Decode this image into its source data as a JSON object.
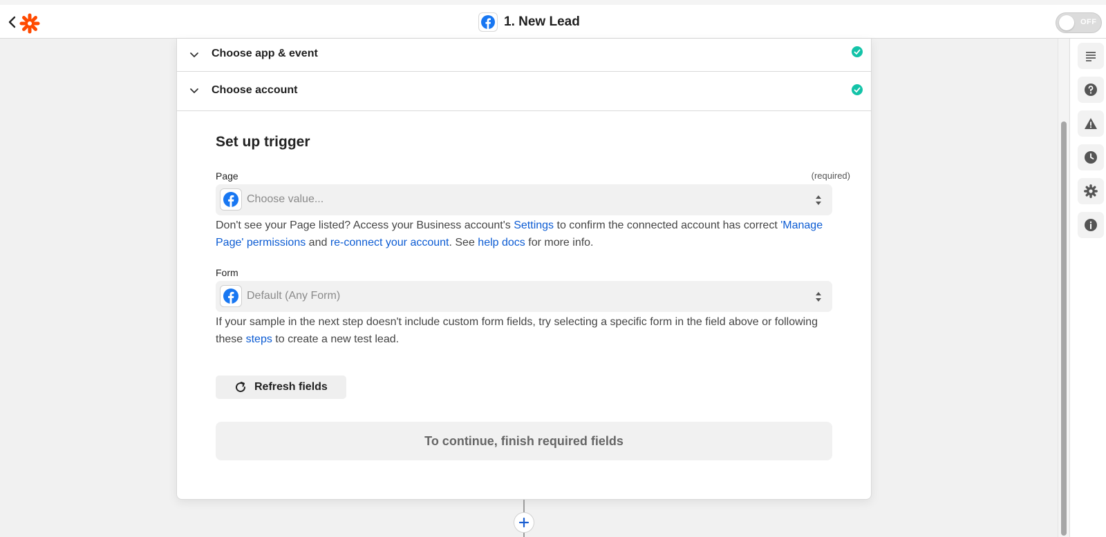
{
  "header": {
    "title": "1. New Lead",
    "toggle_label": "OFF"
  },
  "sections": {
    "app_event": "Choose app & event",
    "account": "Choose account"
  },
  "setup": {
    "title": "Set up trigger",
    "page_label": "Page",
    "required": "(required)",
    "page_placeholder": "Choose value...",
    "page_help": {
      "t1": "Don't see your Page listed? Access your Business account's ",
      "settings": "Settings",
      "t2": " to confirm the connected account has correct ",
      "manage": "'Manage Page' permissions",
      "t3": " and ",
      "reconnect": "re-connect your account",
      "t4": ". See ",
      "help_docs": "help docs",
      "t5": " for more info."
    },
    "form_label": "Form",
    "form_value": "Default (Any Form)",
    "form_help": {
      "t1": "If your sample in the next step doesn't include custom form fields, try selecting a specific form in the field above or following these ",
      "steps": "steps",
      "t2": " to create a new test lead."
    },
    "refresh_label": "Refresh fields",
    "continue_label": "To continue, finish required fields"
  },
  "colors": {
    "brand": "#ff4a00",
    "facebook": "#1877f2",
    "success": "#13c3a8",
    "link": "#0b5bd3"
  },
  "icons": [
    "back-icon",
    "zapier-logo-icon",
    "facebook-icon",
    "chevron-down-icon",
    "check-icon",
    "select-arrows-icon",
    "refresh-icon",
    "plus-icon",
    "notes-icon",
    "help-icon",
    "warning-icon",
    "history-icon",
    "settings-icon",
    "info-icon"
  ]
}
